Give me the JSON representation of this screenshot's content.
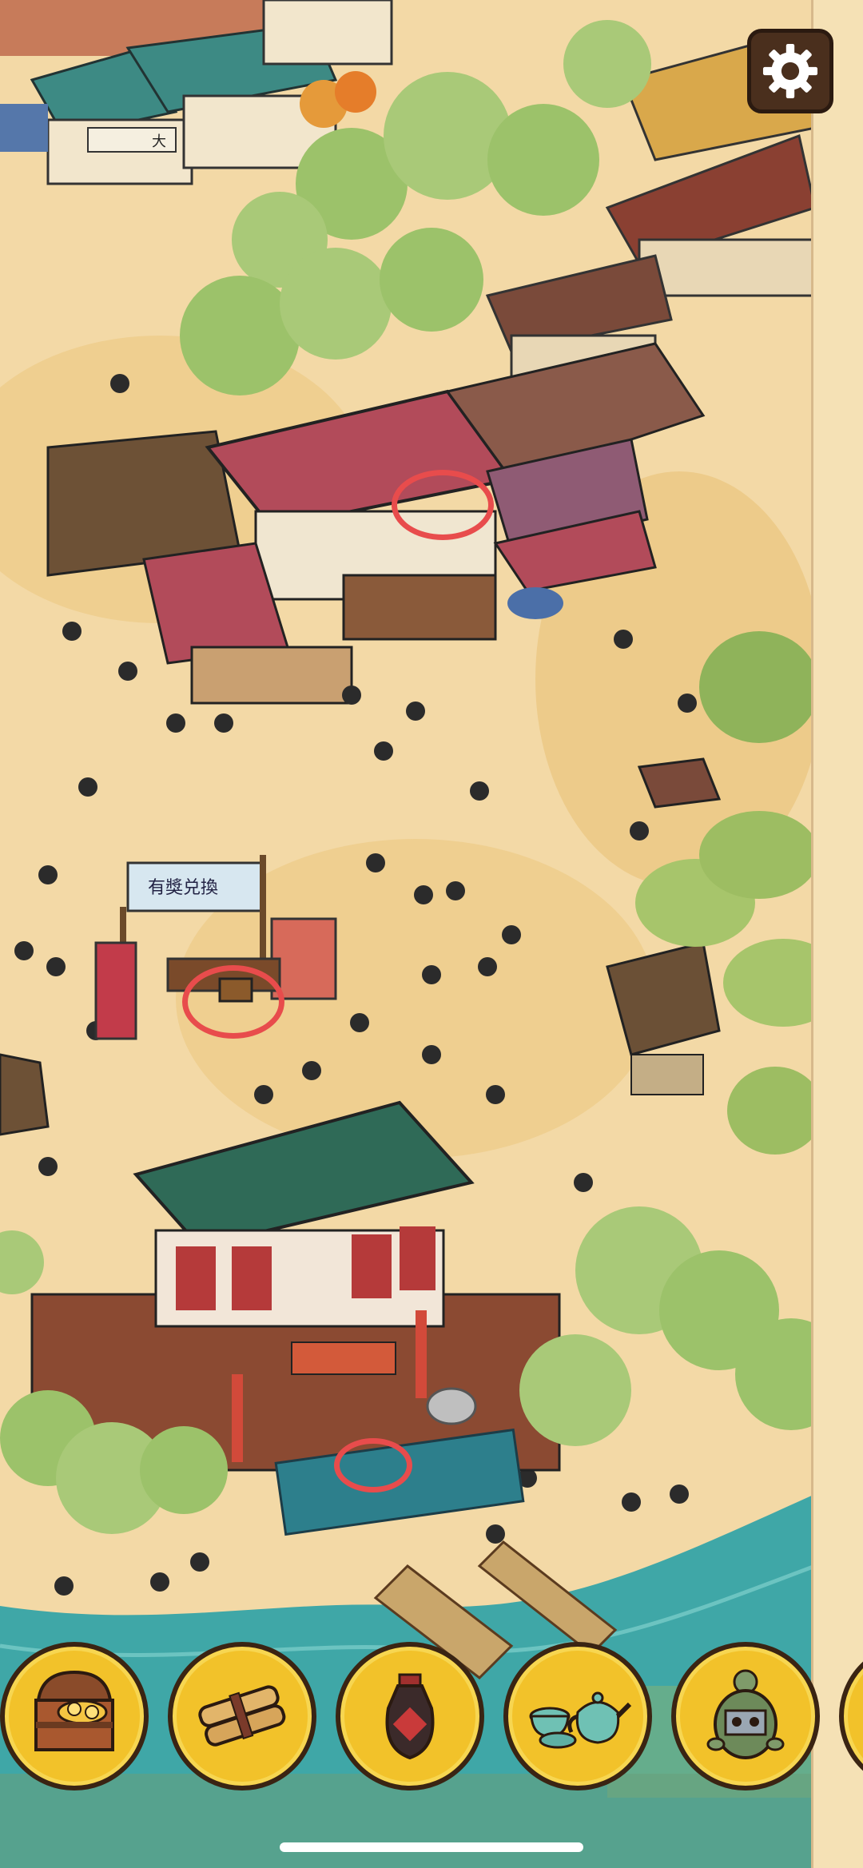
{
  "app": {
    "screen": "hidden-objects-game",
    "settings_icon": "gear-icon"
  },
  "scene": {
    "signs": {
      "top_shop_sign": "大",
      "stall_banner": "有獎兑換"
    },
    "found_markers": [
      {
        "id": "found-marker-balcony",
        "color": "#e84c4c"
      },
      {
        "id": "found-marker-chest",
        "color": "#e84c4c"
      },
      {
        "id": "found-marker-stone-figure",
        "color": "#e84c4c"
      }
    ]
  },
  "inventory": {
    "items": [
      {
        "icon": "treasure-chest-icon"
      },
      {
        "icon": "scroll-bundle-icon"
      },
      {
        "icon": "wine-jar-icon"
      },
      {
        "icon": "teapot-set-icon"
      },
      {
        "icon": "turtle-icon"
      },
      {
        "icon": "partial-item-icon"
      }
    ]
  },
  "colors": {
    "sand": "#f3d9a6",
    "water": "#3fa7a7",
    "roof_red": "#b24b5a",
    "roof_green": "#2f6a57",
    "marker_red": "#e84c4c",
    "slot_yellow": "#f2c22a",
    "slot_border": "#3a2413"
  }
}
